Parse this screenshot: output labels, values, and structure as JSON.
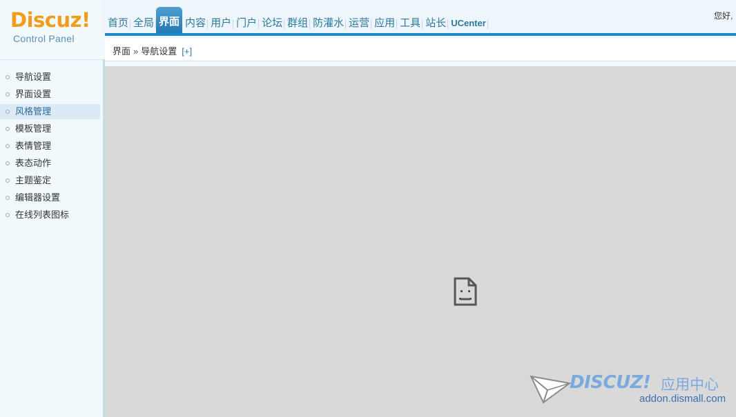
{
  "header": {
    "logo": "Discuz!",
    "logo_sub": "Control Panel",
    "greeting": "您好,"
  },
  "nav": {
    "items": [
      {
        "label": "首页"
      },
      {
        "label": "全局"
      },
      {
        "label": "界面"
      },
      {
        "label": "内容"
      },
      {
        "label": "用户"
      },
      {
        "label": "门户"
      },
      {
        "label": "论坛"
      },
      {
        "label": "群组"
      },
      {
        "label": "防灌水"
      },
      {
        "label": "运营"
      },
      {
        "label": "应用"
      },
      {
        "label": "工具"
      },
      {
        "label": "站长"
      },
      {
        "label": "UCenter"
      }
    ],
    "active": "界面"
  },
  "breadcrumb": {
    "section": "界面",
    "separator": "»",
    "page": "导航设置",
    "add": "[+]"
  },
  "search": {
    "value": ""
  },
  "sidebar": {
    "items": [
      {
        "label": "导航设置"
      },
      {
        "label": "界面设置"
      },
      {
        "label": "风格管理"
      },
      {
        "label": "模板管理"
      },
      {
        "label": "表情管理"
      },
      {
        "label": "表态动作"
      },
      {
        "label": "主题鉴定"
      },
      {
        "label": "编辑器设置"
      },
      {
        "label": "在线列表图标"
      }
    ],
    "active": "风格管理"
  },
  "main": {
    "content_icon": "broken-page-icon"
  },
  "watermark": {
    "logo": "DISCUZ!",
    "cn": "应用中心",
    "url": "addon.dismall.com"
  },
  "colors": {
    "logo": "#f29c1c",
    "nav_text": "#2a7aa0",
    "nav_active_bg": "#2277b3",
    "nav_bar": "#1c8ac4",
    "sidebar_bg": "#f2f9fd",
    "sidebar_active_bg": "#dbeaf4",
    "main_bg": "#d9d9d9"
  }
}
